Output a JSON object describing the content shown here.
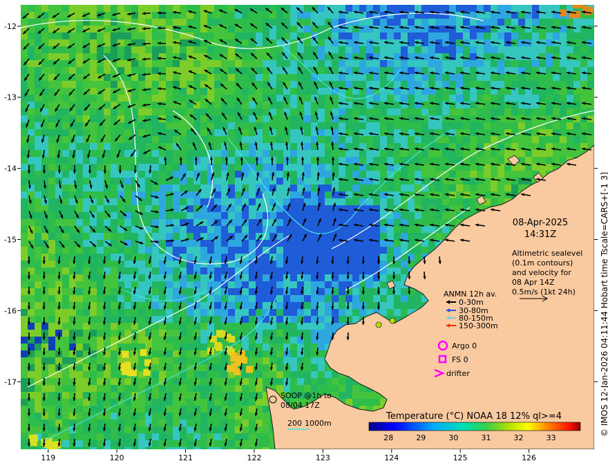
{
  "map": {
    "x_ticks": [
      "119",
      "120",
      "121",
      "122",
      "123",
      "124",
      "125",
      "126"
    ],
    "y_ticks": [
      "-12",
      "-13",
      "-14",
      "-15",
      "-16",
      "-17"
    ],
    "x_range": [
      118.6,
      126.95
    ],
    "y_range": [
      -17.95,
      -11.7
    ],
    "colors": {
      "land": "#f9c9a0",
      "coast": "#1a1a1a",
      "arrow": "#000000",
      "contour_white": "#ffffff",
      "contour_cyan": "#48e2e8"
    }
  },
  "date": {
    "date": "08-Apr-2025",
    "time": "14:31Z"
  },
  "altimetry": {
    "lines": [
      "Altimetric sealevel",
      "(0.1m contours)",
      "and velocity for",
      "08 Apr 14Z",
      "0.5m/s (1kt 24h)"
    ]
  },
  "anmn": {
    "title": "ANMN 12h av.",
    "items": [
      {
        "label": "0-30m",
        "color": "#000000"
      },
      {
        "label": "30-80m",
        "color": "#1f4fff"
      },
      {
        "label": "80-150m",
        "color": "#7ad0e0"
      },
      {
        "label": "150-300m",
        "color": "#ff2a00"
      }
    ]
  },
  "markers": {
    "argo": {
      "label": "Argo 0",
      "color": "#ff00ff"
    },
    "fs": {
      "label": "FS 0",
      "color": "#ff00ff"
    },
    "drifter": {
      "label": "drifter",
      "color": "#ff00ff"
    }
  },
  "soop": {
    "line1": "SOOP @1h to",
    "line2": "08/04 17Z"
  },
  "depth_legend": {
    "a": "200",
    "b": "1000m"
  },
  "colorbar": {
    "title": "Temperature (°C) NOAA 18 12% ql>=4",
    "ticks": [
      "28",
      "29",
      "30",
      "31",
      "32",
      "33"
    ],
    "range": [
      27.4,
      33.9
    ]
  },
  "side_label": "© IMOS 12-Jan-2026 04:11:44 Hobart time Tscale=CARS+[-1 3]",
  "chart_data": {
    "type": "heatmap",
    "title": "Temperature (°C) NOAA 18 12% ql>=4",
    "xlabel": "",
    "ylabel": "",
    "x_ticks": [
      119,
      120,
      121,
      122,
      123,
      124,
      125,
      126
    ],
    "y_ticks": [
      -12,
      -13,
      -14,
      -15,
      -16,
      -17
    ],
    "color_range": [
      27.4,
      33.9
    ],
    "colormap": "jet"
  }
}
